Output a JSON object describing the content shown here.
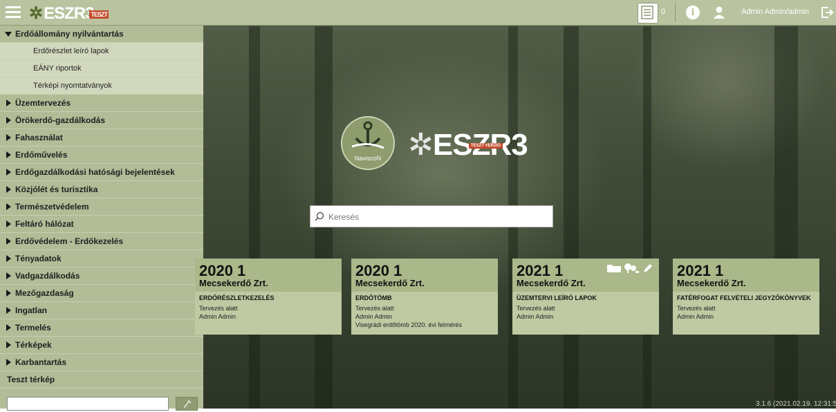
{
  "header": {
    "logo_text": "ESZR3",
    "logo_badge": "TESZT",
    "print_count": "0",
    "user_label": "Admin Admin/admin"
  },
  "sidebar": {
    "items": [
      {
        "label": "Erdőállomány nyilvántartás",
        "open": true,
        "children": [
          "Erdőrészlet leíró lapok",
          "EÁNY riportok",
          "Térképi nyomtatványok"
        ]
      },
      {
        "label": "Üzemtervezés"
      },
      {
        "label": "Örökerdő-gazdálkodás"
      },
      {
        "label": "Fahasználat"
      },
      {
        "label": "Erdőművelés"
      },
      {
        "label": "Erdőgazdálkodási hatósági bejelentések"
      },
      {
        "label": "Közjólét és turisztika"
      },
      {
        "label": "Természetvédelem"
      },
      {
        "label": "Feltáró hálózat"
      },
      {
        "label": "Erdővédelem - Erdőkezelés"
      },
      {
        "label": "Tényadatok"
      },
      {
        "label": "Vadgazdálkodás"
      },
      {
        "label": "Mezőgazdaság"
      },
      {
        "label": "Ingatlan"
      },
      {
        "label": "Termelés"
      },
      {
        "label": "Térképek"
      },
      {
        "label": "Karbantartás"
      },
      {
        "label": "Teszt térkép",
        "plain": true
      }
    ],
    "search_value": ""
  },
  "center": {
    "navis_label": "NaviscoN",
    "brand": "ESZR3",
    "brand_badge": "TESZT VERZIÓ",
    "search_placeholder": "Keresés"
  },
  "cards": [
    {
      "year": "2020 1",
      "org": "Mecsekerdő Zrt.",
      "type": "ERDŐRÉSZLETKEZELÉS",
      "lines": [
        "Tervezés alatt",
        "Admin Admin"
      ]
    },
    {
      "year": "2020 1",
      "org": "Mecsekerdő Zrt.",
      "type": "ERDŐTÖMB",
      "lines": [
        "Tervezés alatt",
        "Admin Admin",
        "Visegrádi erdőtömb 2020. évi felmérés"
      ]
    },
    {
      "year": "2021 1",
      "org": "Mecsekerdő Zrt.",
      "type": "ÜZEMTERVI LEÍRÓ LAPOK",
      "lines": [
        "Tervezés alatt",
        "Admin Admin"
      ],
      "tools": true
    },
    {
      "year": "2021 1",
      "org": "Mecsekerdő Zrt.",
      "type": "FATÉRFOGAT FELVÉTELI JEGYZŐKÖNYVEK",
      "lines": [
        "Tervezés alatt",
        "Admin Admin"
      ]
    }
  ],
  "footer": {
    "version": "3.1.6 (2021.02.19. 12:31:5"
  },
  "colors": {
    "topbar": "#b9c39f",
    "sidebar": "#b2bc97",
    "card_head": "#aab88a",
    "card_body": "#bfc9a2",
    "badge": "#c34a2c"
  }
}
